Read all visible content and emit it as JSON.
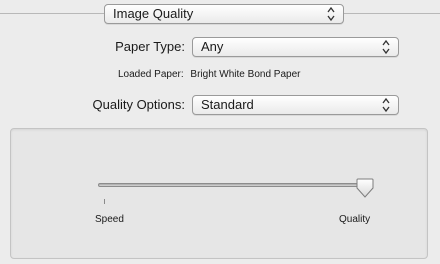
{
  "header": {
    "section_popup_value": "Image Quality"
  },
  "paper_type": {
    "label": "Paper Type:",
    "value": "Any"
  },
  "loaded_paper": {
    "label": "Loaded Paper:",
    "value": "Bright White Bond Paper"
  },
  "quality_options": {
    "label": "Quality Options:",
    "value": "Standard"
  },
  "slider": {
    "min_label": "Speed",
    "max_label": "Quality",
    "level_fraction": 1.0
  },
  "icons": {
    "popup_arrows": "up-down-chevrons-icon",
    "thumb": "slider-thumb-icon"
  }
}
